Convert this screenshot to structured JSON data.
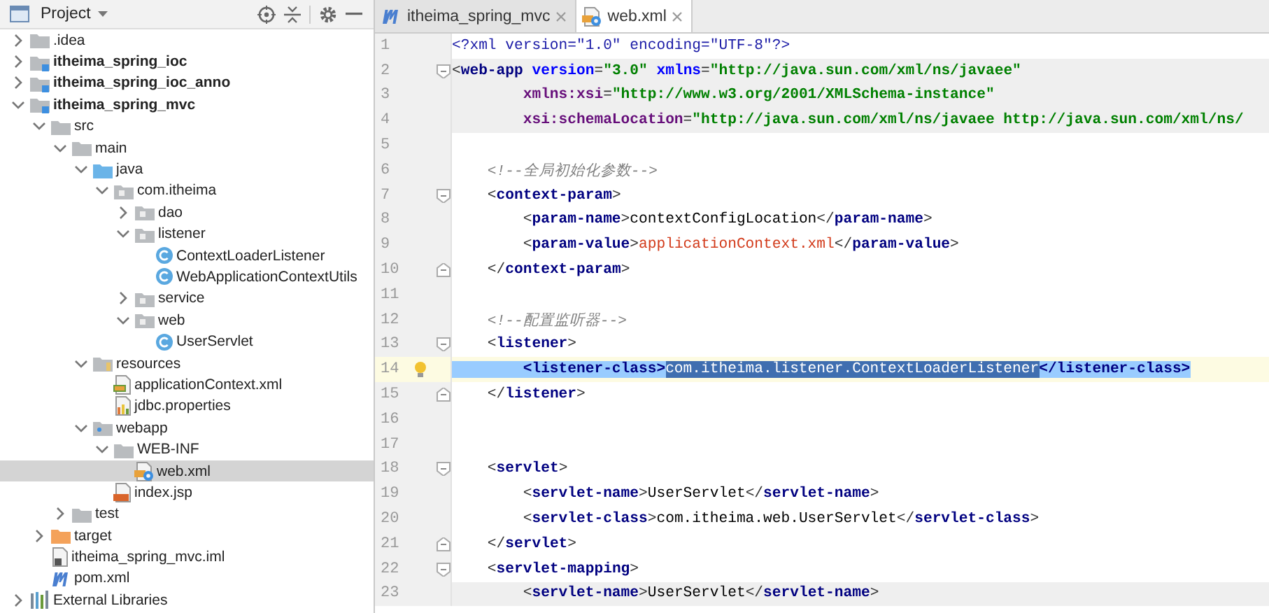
{
  "project_panel": {
    "title": "Project",
    "tree": [
      {
        "label": ".idea",
        "kind": "folder",
        "expanded": false,
        "selected": false,
        "bold": false,
        "has_children": true
      },
      {
        "label": "itheima_spring_ioc",
        "kind": "module",
        "expanded": false,
        "selected": false,
        "bold": true,
        "has_children": true
      },
      {
        "label": "itheima_spring_ioc_anno",
        "kind": "module",
        "expanded": false,
        "selected": false,
        "bold": true,
        "has_children": true
      },
      {
        "label": "itheima_spring_mvc",
        "kind": "module",
        "expanded": true,
        "selected": false,
        "bold": true,
        "has_children": true,
        "children": [
          {
            "label": "src",
            "kind": "folder",
            "expanded": true,
            "selected": false,
            "bold": false,
            "has_children": true,
            "children": [
              {
                "label": "main",
                "kind": "folder",
                "expanded": true,
                "selected": false,
                "bold": false,
                "has_children": true,
                "children": [
                  {
                    "label": "java",
                    "kind": "source-folder",
                    "expanded": true,
                    "selected": false,
                    "bold": false,
                    "has_children": true,
                    "children": [
                      {
                        "label": "com.itheima",
                        "kind": "package",
                        "expanded": true,
                        "selected": false,
                        "bold": false,
                        "has_children": true,
                        "children": [
                          {
                            "label": "dao",
                            "kind": "package",
                            "expanded": false,
                            "selected": false,
                            "bold": false,
                            "has_children": true
                          },
                          {
                            "label": "listener",
                            "kind": "package",
                            "expanded": true,
                            "selected": false,
                            "bold": false,
                            "has_children": true,
                            "children": [
                              {
                                "label": "ContextLoaderListener",
                                "kind": "class",
                                "selected": false,
                                "bold": false,
                                "has_children": false
                              },
                              {
                                "label": "WebApplicationContextUtils",
                                "kind": "class",
                                "selected": false,
                                "bold": false,
                                "has_children": false
                              }
                            ]
                          },
                          {
                            "label": "service",
                            "kind": "package",
                            "expanded": false,
                            "selected": false,
                            "bold": false,
                            "has_children": true
                          },
                          {
                            "label": "web",
                            "kind": "package",
                            "expanded": true,
                            "selected": false,
                            "bold": false,
                            "has_children": true,
                            "children": [
                              {
                                "label": "UserServlet",
                                "kind": "class",
                                "selected": false,
                                "bold": false,
                                "has_children": false
                              }
                            ]
                          }
                        ]
                      }
                    ]
                  },
                  {
                    "label": "resources",
                    "kind": "resources-folder",
                    "expanded": true,
                    "selected": false,
                    "bold": false,
                    "has_children": true,
                    "children": [
                      {
                        "label": "applicationContext.xml",
                        "kind": "xml-file",
                        "selected": false,
                        "bold": false,
                        "has_children": false
                      },
                      {
                        "label": "jdbc.properties",
                        "kind": "properties-file",
                        "selected": false,
                        "bold": false,
                        "has_children": false
                      }
                    ]
                  },
                  {
                    "label": "webapp",
                    "kind": "web-folder",
                    "expanded": true,
                    "selected": false,
                    "bold": false,
                    "has_children": true,
                    "children": [
                      {
                        "label": "WEB-INF",
                        "kind": "folder",
                        "expanded": true,
                        "selected": false,
                        "bold": false,
                        "has_children": true,
                        "children": [
                          {
                            "label": "web.xml",
                            "kind": "config-file",
                            "selected": true,
                            "bold": false,
                            "has_children": false
                          }
                        ]
                      },
                      {
                        "label": "index.jsp",
                        "kind": "jsp-file",
                        "selected": false,
                        "bold": false,
                        "has_children": false
                      }
                    ]
                  }
                ]
              },
              {
                "label": "test",
                "kind": "folder",
                "expanded": false,
                "selected": false,
                "bold": false,
                "has_children": true
              }
            ]
          },
          {
            "label": "target",
            "kind": "excluded-folder",
            "expanded": false,
            "selected": false,
            "bold": false,
            "has_children": true
          },
          {
            "label": "itheima_spring_mvc.iml",
            "kind": "iml-file",
            "selected": false,
            "bold": false,
            "has_children": false
          },
          {
            "label": "pom.xml",
            "kind": "maven-file",
            "selected": false,
            "bold": false,
            "has_children": false
          }
        ]
      },
      {
        "label": "External Libraries",
        "kind": "libraries",
        "expanded": false,
        "selected": false,
        "bold": false,
        "has_children": true
      }
    ]
  },
  "editor": {
    "tabs": [
      {
        "label": "itheima_spring_mvc",
        "kind": "maven-file",
        "selected": false
      },
      {
        "label": "web.xml",
        "kind": "config-file",
        "selected": true
      }
    ],
    "lines": [
      {
        "number": "1",
        "shaded": false,
        "current": false,
        "fold_open": false,
        "fold_close": false,
        "segments": [
          {
            "kind": "pi",
            "text": "<?xml version=\"1.0\" encoding=\"UTF-8\"?>"
          }
        ]
      },
      {
        "number": "2",
        "shaded": true,
        "current": false,
        "fold_open": true,
        "fold_close": false,
        "segments": [
          {
            "kind": "punct",
            "text": "<"
          },
          {
            "kind": "tag",
            "text": "web-app"
          },
          {
            "kind": "attr",
            "text": " version"
          },
          {
            "kind": "punct",
            "text": "="
          },
          {
            "kind": "value",
            "text": "\"3.0\""
          },
          {
            "kind": "attr",
            "text": " xmlns"
          },
          {
            "kind": "punct",
            "text": "="
          },
          {
            "kind": "value",
            "text": "\"http://java.sun.com/xml/ns/javaee\""
          }
        ]
      },
      {
        "number": "3",
        "shaded": true,
        "current": false,
        "fold_open": false,
        "fold_close": false,
        "segments": [
          {
            "kind": "ns",
            "text": "        xmlns:xsi"
          },
          {
            "kind": "punct",
            "text": "="
          },
          {
            "kind": "value",
            "text": "\"http://www.w3.org/2001/XMLSchema-instance\""
          }
        ]
      },
      {
        "number": "4",
        "shaded": true,
        "current": false,
        "fold_open": false,
        "fold_close": false,
        "segments": [
          {
            "kind": "ns",
            "text": "        xsi:schemaLocation"
          },
          {
            "kind": "punct",
            "text": "="
          },
          {
            "kind": "value",
            "text": "\"http://java.sun.com/xml/ns/javaee http://java.sun.com/xml/ns/"
          }
        ]
      },
      {
        "number": "5",
        "shaded": false,
        "current": false,
        "fold_open": false,
        "fold_close": false
      },
      {
        "number": "6",
        "shaded": false,
        "current": false,
        "fold_open": false,
        "fold_close": false,
        "segments": [
          {
            "kind": "comment",
            "text": "    <!--全局初始化参数-->"
          }
        ]
      },
      {
        "number": "7",
        "shaded": false,
        "current": false,
        "fold_open": true,
        "fold_close": false,
        "segments": [
          {
            "kind": "punct",
            "text": "    <"
          },
          {
            "kind": "tag",
            "text": "context-param"
          },
          {
            "kind": "punct",
            "text": ">"
          }
        ]
      },
      {
        "number": "8",
        "shaded": false,
        "current": false,
        "fold_open": false,
        "fold_close": false,
        "segments": [
          {
            "kind": "punct",
            "text": "        <"
          },
          {
            "kind": "tag",
            "text": "param-name"
          },
          {
            "kind": "punct",
            "text": ">"
          },
          {
            "kind": "text",
            "text": "contextConfigLocation"
          },
          {
            "kind": "punct",
            "text": "</"
          },
          {
            "kind": "tag",
            "text": "param-name"
          },
          {
            "kind": "punct",
            "text": ">"
          }
        ]
      },
      {
        "number": "9",
        "shaded": false,
        "current": false,
        "fold_open": false,
        "fold_close": false,
        "segments": [
          {
            "kind": "punct",
            "text": "        <"
          },
          {
            "kind": "tag",
            "text": "param-value"
          },
          {
            "kind": "punct",
            "text": ">"
          },
          {
            "kind": "string",
            "text": "applicationContext.xml"
          },
          {
            "kind": "punct",
            "text": "</"
          },
          {
            "kind": "tag",
            "text": "param-value"
          },
          {
            "kind": "punct",
            "text": ">"
          }
        ]
      },
      {
        "number": "10",
        "shaded": false,
        "current": false,
        "fold_open": false,
        "fold_close": true,
        "segments": [
          {
            "kind": "punct",
            "text": "    </"
          },
          {
            "kind": "tag",
            "text": "context-param"
          },
          {
            "kind": "punct",
            "text": ">"
          }
        ]
      },
      {
        "number": "11",
        "shaded": false,
        "current": false,
        "fold_open": false,
        "fold_close": false
      },
      {
        "number": "12",
        "shaded": false,
        "current": false,
        "fold_open": false,
        "fold_close": false,
        "segments": [
          {
            "kind": "comment",
            "text": "    <!--配置监听器-->"
          }
        ]
      },
      {
        "number": "13",
        "shaded": false,
        "current": false,
        "fold_open": true,
        "fold_close": false,
        "segments": [
          {
            "kind": "punct",
            "text": "    <"
          },
          {
            "kind": "tag",
            "text": "listener"
          },
          {
            "kind": "punct",
            "text": ">"
          }
        ]
      },
      {
        "number": "14",
        "shaded": false,
        "current": true,
        "fold_open": false,
        "fold_close": false,
        "bulb": true,
        "segments": [
          {
            "kind": "match",
            "text": "        <listener-class>"
          },
          {
            "kind": "selection",
            "text": "com.itheima.listener.ContextLoaderListener"
          },
          {
            "kind": "match",
            "text": "</listener-class>"
          }
        ]
      },
      {
        "number": "15",
        "shaded": false,
        "current": false,
        "fold_open": false,
        "fold_close": true,
        "segments": [
          {
            "kind": "punct",
            "text": "    </"
          },
          {
            "kind": "tag",
            "text": "listener"
          },
          {
            "kind": "punct",
            "text": ">"
          }
        ]
      },
      {
        "number": "16",
        "shaded": false,
        "current": false,
        "fold_open": false,
        "fold_close": false
      },
      {
        "number": "17",
        "shaded": false,
        "current": false,
        "fold_open": false,
        "fold_close": false
      },
      {
        "number": "18",
        "shaded": false,
        "current": false,
        "fold_open": true,
        "fold_close": false,
        "segments": [
          {
            "kind": "punct",
            "text": "    <"
          },
          {
            "kind": "tag",
            "text": "servlet"
          },
          {
            "kind": "punct",
            "text": ">"
          }
        ]
      },
      {
        "number": "19",
        "shaded": false,
        "current": false,
        "fold_open": false,
        "fold_close": false,
        "segments": [
          {
            "kind": "punct",
            "text": "        <"
          },
          {
            "kind": "tag",
            "text": "servlet-name"
          },
          {
            "kind": "punct",
            "text": ">"
          },
          {
            "kind": "text",
            "text": "UserServlet"
          },
          {
            "kind": "punct",
            "text": "</"
          },
          {
            "kind": "tag",
            "text": "servlet-name"
          },
          {
            "kind": "punct",
            "text": ">"
          }
        ]
      },
      {
        "number": "20",
        "shaded": false,
        "current": false,
        "fold_open": false,
        "fold_close": false,
        "segments": [
          {
            "kind": "punct",
            "text": "        <"
          },
          {
            "kind": "tag",
            "text": "servlet-class"
          },
          {
            "kind": "punct",
            "text": ">"
          },
          {
            "kind": "text",
            "text": "com.itheima.web.UserServlet"
          },
          {
            "kind": "punct",
            "text": "</"
          },
          {
            "kind": "tag",
            "text": "servlet-class"
          },
          {
            "kind": "punct",
            "text": ">"
          }
        ]
      },
      {
        "number": "21",
        "shaded": false,
        "current": false,
        "fold_open": false,
        "fold_close": true,
        "segments": [
          {
            "kind": "punct",
            "text": "    </"
          },
          {
            "kind": "tag",
            "text": "servlet"
          },
          {
            "kind": "punct",
            "text": ">"
          }
        ]
      },
      {
        "number": "22",
        "shaded": false,
        "current": false,
        "fold_open": true,
        "fold_close": false,
        "segments": [
          {
            "kind": "punct",
            "text": "    <"
          },
          {
            "kind": "tag",
            "text": "servlet-mapping"
          },
          {
            "kind": "punct",
            "text": ">"
          }
        ]
      },
      {
        "number": "23",
        "shaded": true,
        "current": false,
        "fold_open": false,
        "fold_close": false,
        "segments": [
          {
            "kind": "punct",
            "text": "        <"
          },
          {
            "kind": "tag",
            "text": "servlet-name"
          },
          {
            "kind": "punct",
            "text": ">"
          },
          {
            "kind": "text",
            "text": "UserServlet"
          },
          {
            "kind": "punct",
            "text": "</"
          },
          {
            "kind": "tag",
            "text": "servlet-name"
          },
          {
            "kind": "punct",
            "text": ">"
          }
        ]
      }
    ]
  }
}
